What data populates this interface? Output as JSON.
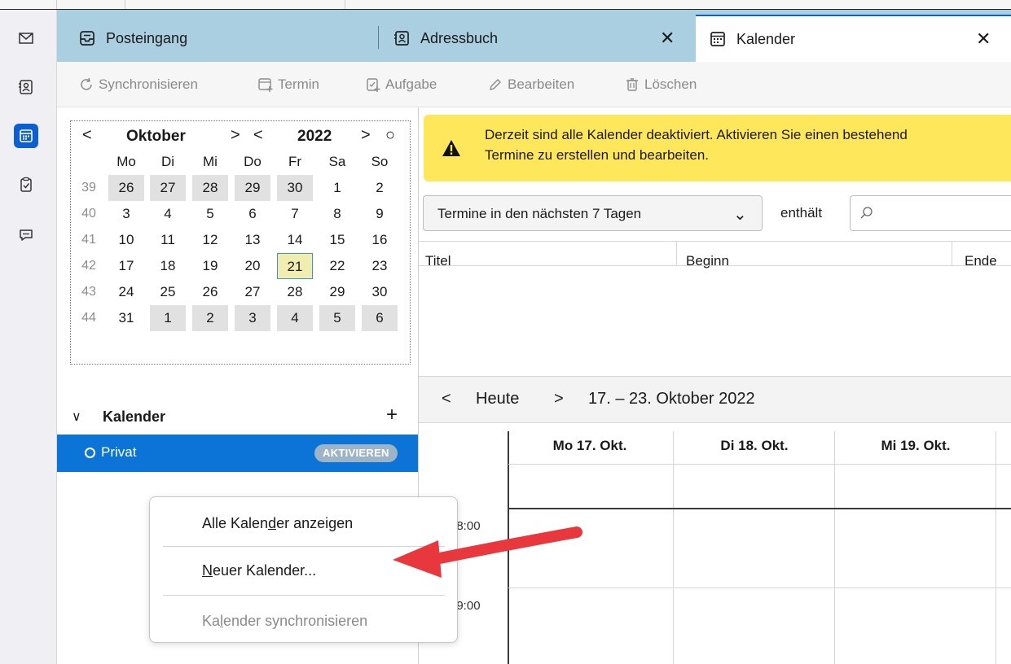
{
  "tabs": {
    "inbox": "Posteingang",
    "addressbook": "Adressbuch",
    "calendar": "Kalender",
    "close_glyph": "✕"
  },
  "toolbar": {
    "sync": "Synchronisieren",
    "event": "Termin",
    "task": "Aufgabe",
    "edit": "Bearbeiten",
    "delete": "Löschen"
  },
  "minimonth": {
    "month": "Oktober",
    "year": "2022",
    "prev": "<",
    "next": ">",
    "today_glyph": "○",
    "weekdays": [
      "Mo",
      "Di",
      "Mi",
      "Do",
      "Fr",
      "Sa",
      "So"
    ],
    "weeks": [
      {
        "wk": "39",
        "days": [
          "26",
          "27",
          "28",
          "29",
          "30",
          "1",
          "2"
        ]
      },
      {
        "wk": "40",
        "days": [
          "3",
          "4",
          "5",
          "6",
          "7",
          "8",
          "9"
        ]
      },
      {
        "wk": "41",
        "days": [
          "10",
          "11",
          "12",
          "13",
          "14",
          "15",
          "16"
        ]
      },
      {
        "wk": "42",
        "days": [
          "17",
          "18",
          "19",
          "20",
          "21",
          "22",
          "23"
        ]
      },
      {
        "wk": "43",
        "days": [
          "24",
          "25",
          "26",
          "27",
          "28",
          "29",
          "30"
        ]
      },
      {
        "wk": "44",
        "days": [
          "31",
          "1",
          "2",
          "3",
          "4",
          "5",
          "6"
        ]
      }
    ],
    "selected_day": "21"
  },
  "calendars": {
    "section_title": "Kalender",
    "chevron": "∨",
    "add": "+",
    "items": [
      {
        "name": "Privat",
        "badge": "AKTIVIEREN"
      }
    ]
  },
  "context_menu": {
    "items": [
      {
        "pre": "Alle Kalen",
        "key": "d",
        "post": "er anzeigen",
        "enabled": true
      },
      {
        "pre": "",
        "key": "N",
        "post": "euer Kalender...",
        "enabled": true
      },
      {
        "pre": "Ka",
        "key": "l",
        "post": "ender synchronisieren",
        "enabled": false
      }
    ]
  },
  "notification": {
    "line1": "Derzeit sind alle Kalender deaktiviert. Aktivieren Sie einen bestehend",
    "line2": "Termine zu erstellen und bearbeiten."
  },
  "filter": {
    "selected": "Termine in den nächsten 7 Tagen",
    "contains_label": "enthält",
    "search_value": ""
  },
  "list_columns": [
    "Titel",
    "Beginn",
    "Ende"
  ],
  "week_view": {
    "prev": "<",
    "today": "Heute",
    "next": ">",
    "range": "17. – 23. Oktober 2022",
    "days": [
      "Mo 17. Okt.",
      "Di 18. Okt.",
      "Mi 19. Okt."
    ],
    "times": [
      "08:00",
      "09:00"
    ]
  },
  "colors": {
    "accent": "#0b5fd0",
    "tabbar": "#a9cfe0",
    "notification": "#ffe75c",
    "arrow": "#e8383d"
  }
}
